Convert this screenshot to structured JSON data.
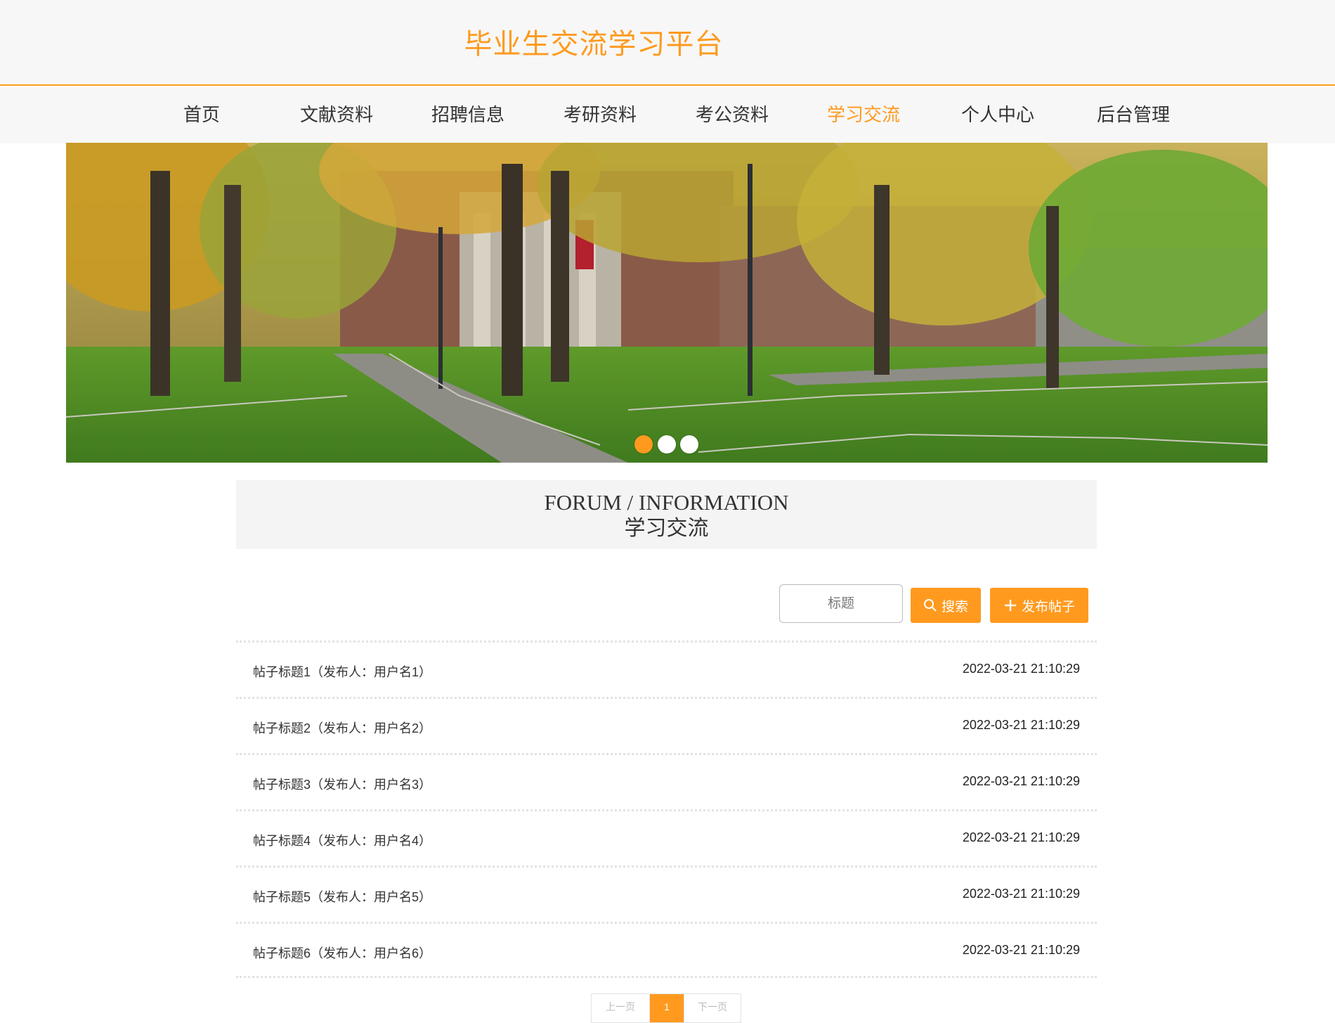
{
  "header": {
    "site_title": "毕业生交流学习平台"
  },
  "nav": {
    "items": [
      {
        "label": "首页"
      },
      {
        "label": "文献资料"
      },
      {
        "label": "招聘信息"
      },
      {
        "label": "考研资料"
      },
      {
        "label": "考公资料"
      },
      {
        "label": "学习交流"
      },
      {
        "label": "个人中心"
      },
      {
        "label": "后台管理"
      }
    ],
    "active": "学习交流"
  },
  "banner": {
    "slide_count": 3,
    "active_slide": 1
  },
  "section": {
    "title_en": "FORUM / INFORMATION",
    "title_cn": "学习交流"
  },
  "search": {
    "placeholder": "标题",
    "search_label": "搜索",
    "post_label": "发布帖子"
  },
  "posts": [
    {
      "title": "帖子标题1（发布人：用户名1）",
      "time": "2022-03-21 21:10:29"
    },
    {
      "title": "帖子标题2（发布人：用户名2）",
      "time": "2022-03-21 21:10:29"
    },
    {
      "title": "帖子标题3（发布人：用户名3）",
      "time": "2022-03-21 21:10:29"
    },
    {
      "title": "帖子标题4（发布人：用户名4）",
      "time": "2022-03-21 21:10:29"
    },
    {
      "title": "帖子标题5（发布人：用户名5）",
      "time": "2022-03-21 21:10:29"
    },
    {
      "title": "帖子标题6（发布人：用户名6）",
      "time": "2022-03-21 21:10:29"
    }
  ],
  "pagination": {
    "prev_label": "上一页",
    "current": "1",
    "next_label": "下一页"
  },
  "colors": {
    "accent": "#ff9a1f",
    "header_bg": "#f7f7f7",
    "section_bg": "#f4f4f4"
  }
}
